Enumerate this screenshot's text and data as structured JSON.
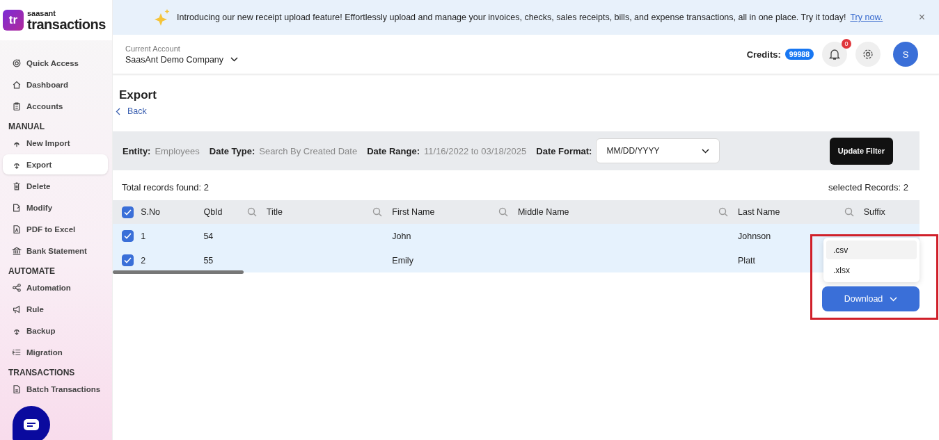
{
  "brand": {
    "logo_mark": "tr",
    "company": "saasant",
    "product": "transactions"
  },
  "banner": {
    "text": "Introducing our new receipt upload feature! Effortlessly upload and manage your invoices, checks, sales receipts, bills, and expense transactions, all in one place. Try it today!",
    "link": "Try now.",
    "close": "×"
  },
  "sidebar": {
    "sections": [
      {
        "items": [
          {
            "label": "Quick Access",
            "selected": false
          },
          {
            "label": "Dashboard",
            "selected": false
          },
          {
            "label": "Accounts",
            "selected": false
          }
        ]
      },
      {
        "heading": "MANUAL",
        "items": [
          {
            "label": "New Import",
            "selected": false
          },
          {
            "label": "Export",
            "selected": true
          },
          {
            "label": "Delete",
            "selected": false
          },
          {
            "label": "Modify",
            "selected": false
          },
          {
            "label": "PDF to Excel",
            "selected": false
          },
          {
            "label": "Bank Statement",
            "selected": false
          }
        ]
      },
      {
        "heading": "AUTOMATE",
        "items": [
          {
            "label": "Automation",
            "selected": false
          },
          {
            "label": "Rule",
            "selected": false
          },
          {
            "label": "Backup",
            "selected": false
          },
          {
            "label": "Migration",
            "selected": false
          }
        ]
      },
      {
        "heading": "TRANSACTIONS",
        "items": [
          {
            "label": "Batch Transactions",
            "selected": false
          }
        ]
      }
    ]
  },
  "header": {
    "account_label": "Current Account",
    "account_value": "SaasAnt Demo Company",
    "credits_label": "Credits:",
    "credits_value": "99988",
    "notification_count": "0",
    "avatar": "S"
  },
  "page": {
    "title": "Export",
    "back": "Back"
  },
  "filters": [
    {
      "label": "Entity:",
      "value": "Employees"
    },
    {
      "label": "Date Type:",
      "value": "Search By Created Date"
    },
    {
      "label": "Date Range:",
      "value": "11/16/2022 to 03/18/2025"
    }
  ],
  "date_format": {
    "label": "Date Format:",
    "value": "MM/DD/YYYY"
  },
  "update_button": "Update Filter",
  "summary": {
    "total": "Total records found: 2",
    "selected": "selected Records: 2"
  },
  "table": {
    "all_checked": true,
    "columns": [
      {
        "label": "S.No",
        "searchable": false
      },
      {
        "label": "QbId",
        "searchable": true
      },
      {
        "label": "Title",
        "searchable": true
      },
      {
        "label": "First Name",
        "searchable": true
      },
      {
        "label": "Middle Name",
        "searchable": true
      },
      {
        "label": "Last Name",
        "searchable": true
      },
      {
        "label": "Suffix",
        "searchable": false
      }
    ],
    "rows": [
      {
        "checked": true,
        "cells": [
          "1",
          "54",
          "",
          "John",
          "",
          "Johnson",
          ""
        ]
      },
      {
        "checked": true,
        "cells": [
          "2",
          "55",
          "",
          "Emily",
          "",
          "Platt",
          ""
        ]
      }
    ]
  },
  "download_menu": {
    "options": [
      {
        "label": ".csv",
        "selected": true
      },
      {
        "label": ".xlsx",
        "selected": false
      }
    ],
    "button": "Download"
  }
}
